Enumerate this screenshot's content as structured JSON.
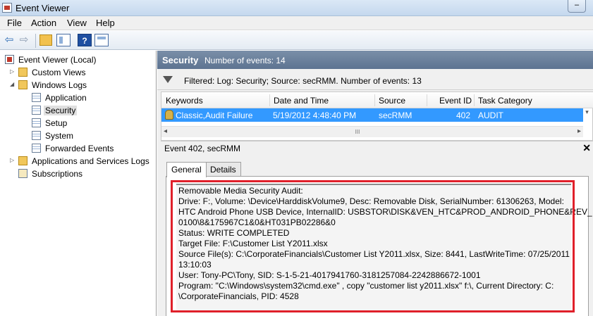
{
  "window": {
    "title": "Event Viewer",
    "minimize_glyph": "–"
  },
  "menu": [
    "File",
    "Action",
    "View",
    "Help"
  ],
  "toolbar": {
    "icons": [
      "back-arrow-icon",
      "forward-arrow-icon",
      "up-folder-icon",
      "show-hide-tree-icon",
      "help-icon",
      "show-hide-action-pane-icon"
    ],
    "help_glyph": "?"
  },
  "tree": {
    "root": "Event Viewer (Local)",
    "custom_views": "Custom Views",
    "windows_logs": "Windows Logs",
    "logs": [
      "Application",
      "Security",
      "Setup",
      "System",
      "Forwarded Events"
    ],
    "apps_services": "Applications and Services Logs",
    "subscriptions": "Subscriptions",
    "selected": "Security"
  },
  "pane": {
    "title": "Security",
    "count_text": "Number of events: 14",
    "filter_text": "Filtered: Log: Security; Source: secRMM. Number of events: 13"
  },
  "columns": [
    "Keywords",
    "Date and Time",
    "Source",
    "Event ID",
    "Task Category"
  ],
  "rows": [
    {
      "keywords": "Classic,Audit Failure",
      "datetime": "5/19/2012 4:48:40 PM",
      "source": "secRMM",
      "event_id": "402",
      "task_category": "AUDIT"
    }
  ],
  "scroll": {
    "left": "◂",
    "right": "▸",
    "grip": "III",
    "down": "▾"
  },
  "detail": {
    "title": "Event 402, secRMM",
    "close_glyph": "✕",
    "tabs": [
      "General",
      "Details"
    ],
    "active_tab": "General",
    "lines": [
      "Removable Media Security Audit:",
      "Drive: F:, Volume: \\Device\\HarddiskVolume9, Desc: Removable Disk, SerialNumber: 61306263, Model:",
      "HTC Android Phone USB Device, InternalID: USBSTOR\\DISK&VEN_HTC&PROD_ANDROID_PHONE&REV_",
      "0100\\8&175967C1&0&HT031PB02286&0",
      "Status: WRITE COMPLETED",
      "Target File: F:\\Customer List Y2011.xlsx",
      "Source File(s): C:\\CorporateFinancials\\Customer List Y2011.xlsx, Size: 8441, LastWriteTime: 07/25/2011",
      "13:10:03",
      "User: Tony-PC\\Tony, SID: S-1-5-21-4017941760-3181257084-2242886672-1001",
      "Program: \"C:\\Windows\\system32\\cmd.exe\" , copy \"customer list y2011.xlsx\" f:\\, Current Directory: C:",
      "\\CorporateFinancials, PID: 4528"
    ]
  },
  "colors": {
    "highlight_box": "#e0202a",
    "selection": "#3399ff"
  }
}
